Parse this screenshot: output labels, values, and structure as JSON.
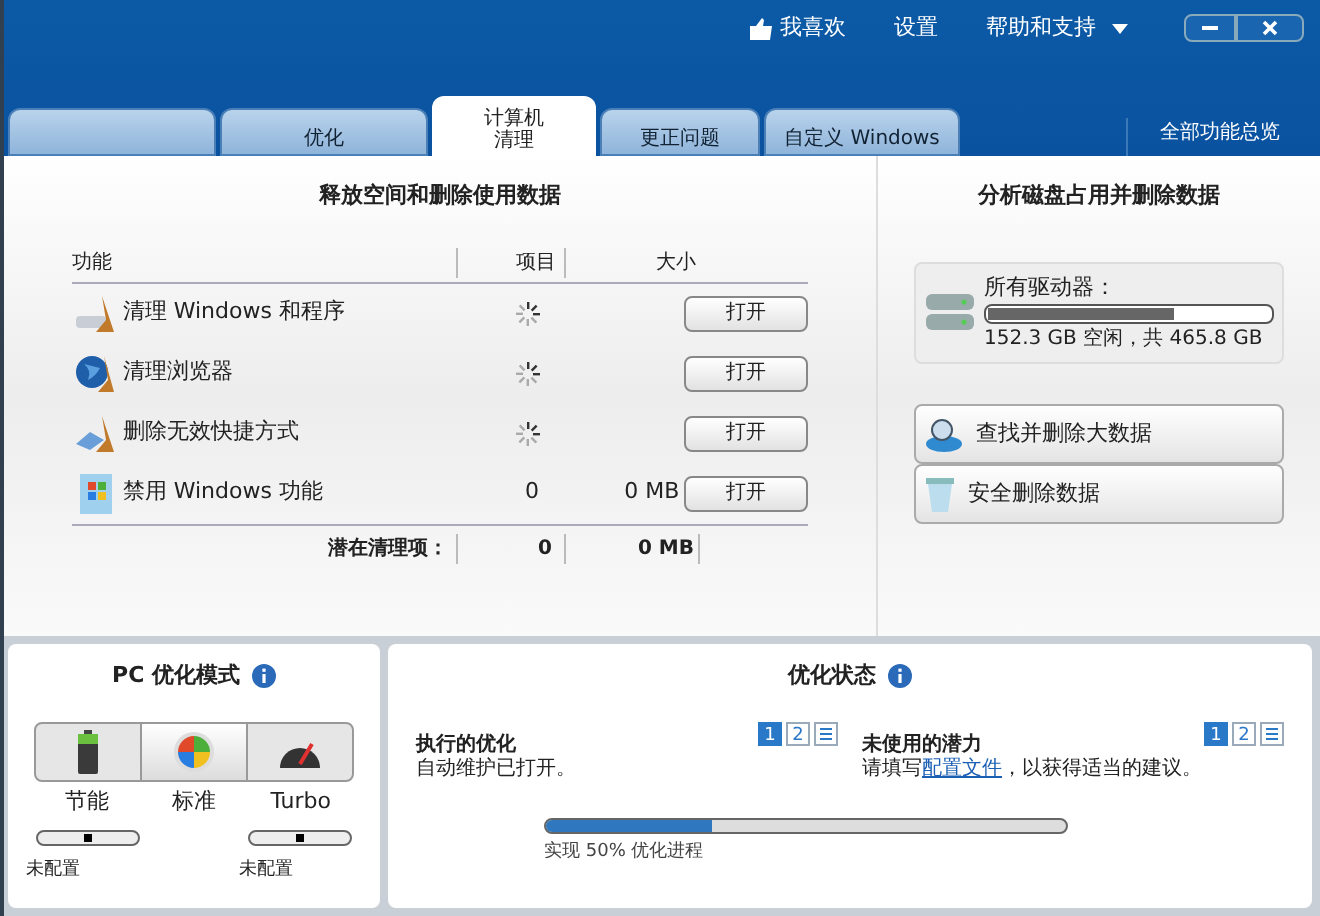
{
  "header": {
    "links": [
      "我喜欢",
      "设置",
      "帮助和支持"
    ]
  },
  "tabs": [
    {
      "selected": false
    },
    {
      "label": "优化",
      "selected": false
    },
    {
      "label": "计算机清理",
      "selected": true
    },
    {
      "label": "更正问题",
      "selected": false
    },
    {
      "label": "自定义 Windows",
      "selected": false
    }
  ],
  "overview_link": "全部功能总览",
  "cleanup": {
    "title": "释放空间和删除使用数据",
    "columns": [
      "功能",
      "项目",
      "大小"
    ],
    "rows": [
      {
        "kind": "disk",
        "name": "清理 Windows 和程序",
        "busy": true,
        "button": "打开"
      },
      {
        "kind": "globe",
        "name": "清理浏览器",
        "busy": true,
        "button": "打开"
      },
      {
        "kind": "shortcut",
        "name": "删除无效快捷方式",
        "busy": true,
        "button": "打开"
      },
      {
        "kind": "windows",
        "name": "禁用 Windows 功能",
        "busy": false,
        "items": "0",
        "size": "0 MB",
        "button": "打开"
      }
    ],
    "total": {
      "label": "潜在清理项：",
      "items": "0",
      "size": "0 MB"
    }
  },
  "disk": {
    "title": "分析磁盘占用并删除数据",
    "drive_label": "所有驱动器：",
    "level": 0.66,
    "reading": "152.3 GB 空闲，共 465.8 GB",
    "actions": [
      {
        "kind": "search",
        "label": "查找并删除大数据"
      },
      {
        "kind": "trash",
        "label": "安全删除数据"
      }
    ]
  },
  "mode": {
    "title": "PC 优化模式",
    "options": [
      {
        "kind": "battery",
        "label": "节能",
        "selected": false,
        "level": 0.5,
        "status": "未配置"
      },
      {
        "kind": "windows",
        "label": "标准",
        "selected": true
      },
      {
        "kind": "gauge",
        "label": "Turbo",
        "selected": false,
        "level": 0.5,
        "status": "未配置"
      }
    ]
  },
  "status": {
    "title": "优化状态",
    "sections": [
      {
        "title": "执行的优化",
        "text": "自动维护已打开。",
        "pages": [
          {
            "label": "1",
            "selected": true
          },
          {
            "label": "2",
            "selected": false
          }
        ]
      },
      {
        "title": "未使用的潜力",
        "text_before": "请填写",
        "link": "配置文件",
        "text_after": "，以获得适当的建议。",
        "pages": [
          {
            "label": "1",
            "selected": true
          },
          {
            "label": "2",
            "selected": false
          }
        ]
      }
    ],
    "level": 0.32,
    "caption": "实现 50% 优化进程"
  }
}
